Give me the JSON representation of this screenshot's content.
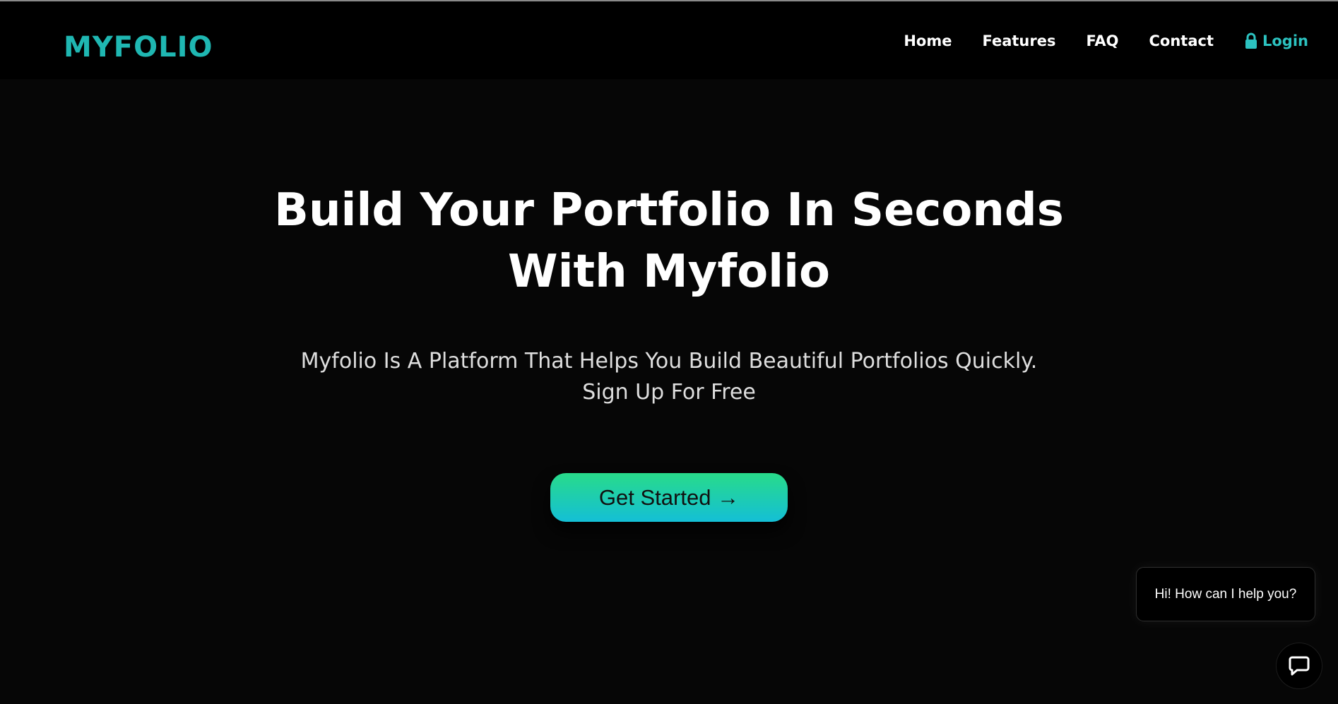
{
  "nav": {
    "brand": "MYFOLIO",
    "links": [
      "Home",
      "Features",
      "FAQ",
      "Contact"
    ],
    "login": "Login",
    "login_icon": "lock-icon"
  },
  "hero": {
    "title_line1": "Build Your Portfolio In Seconds",
    "title_line2": "With Myfolio",
    "subtitle_line1": "Myfolio Is A Platform That Helps You Build Beautiful Portfolios Quickly.",
    "subtitle_line2": "Sign Up For Free",
    "cta": "Get Started →"
  },
  "chat": {
    "message": "Hi! How can I help you?",
    "button_icon": "chat-icon"
  },
  "colors": {
    "background": "#060606",
    "navbar": "#000000",
    "brand": "#1fb7b2",
    "login": "#2cc2c0",
    "cta_gradient_top": "#28db8a",
    "cta_gradient_bottom": "#14bfd6"
  }
}
